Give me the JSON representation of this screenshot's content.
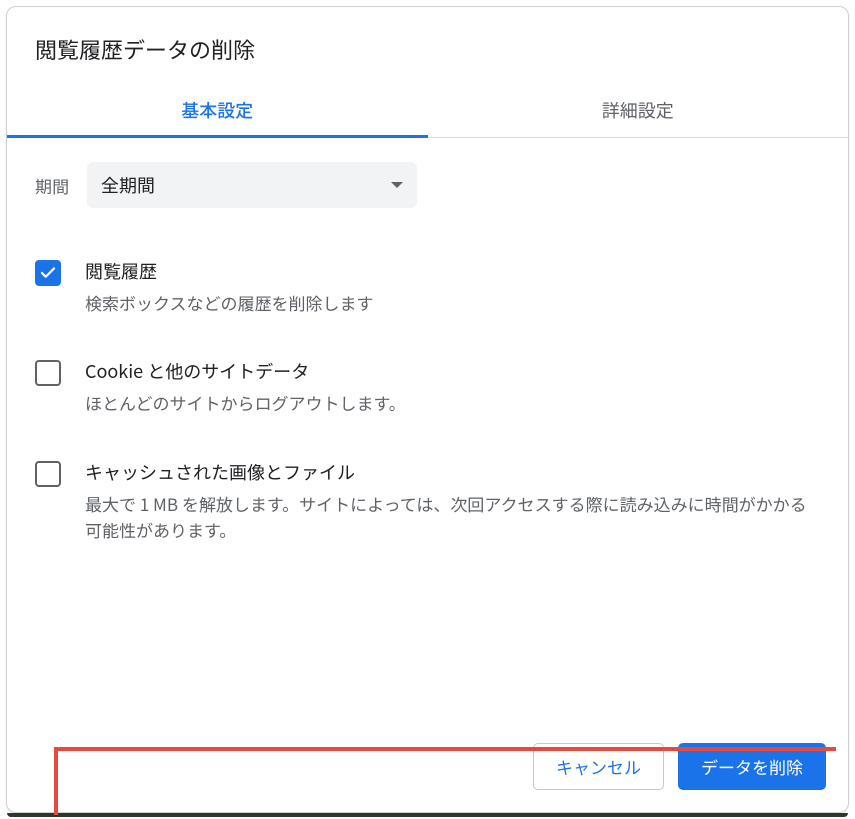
{
  "dialog": {
    "title": "閲覧履歴データの削除"
  },
  "tabs": {
    "basic": "基本設定",
    "advanced": "詳細設定"
  },
  "period": {
    "label": "期間",
    "value": "全期間"
  },
  "options": [
    {
      "checked": true,
      "title": "閲覧履歴",
      "desc": "検索ボックスなどの履歴を削除します"
    },
    {
      "checked": false,
      "title": "Cookie と他のサイトデータ",
      "desc": "ほとんどのサイトからログアウトします。"
    },
    {
      "checked": false,
      "title": "キャッシュされた画像とファイル",
      "desc": "最大で 1 MB を解放します。サイトによっては、次回アクセスする際に読み込みに時間がかかる可能性があります。"
    }
  ],
  "buttons": {
    "cancel": "キャンセル",
    "clear": "データを削除"
  },
  "colors": {
    "accent": "#1a73e8",
    "annotation": "#e44a3f"
  }
}
